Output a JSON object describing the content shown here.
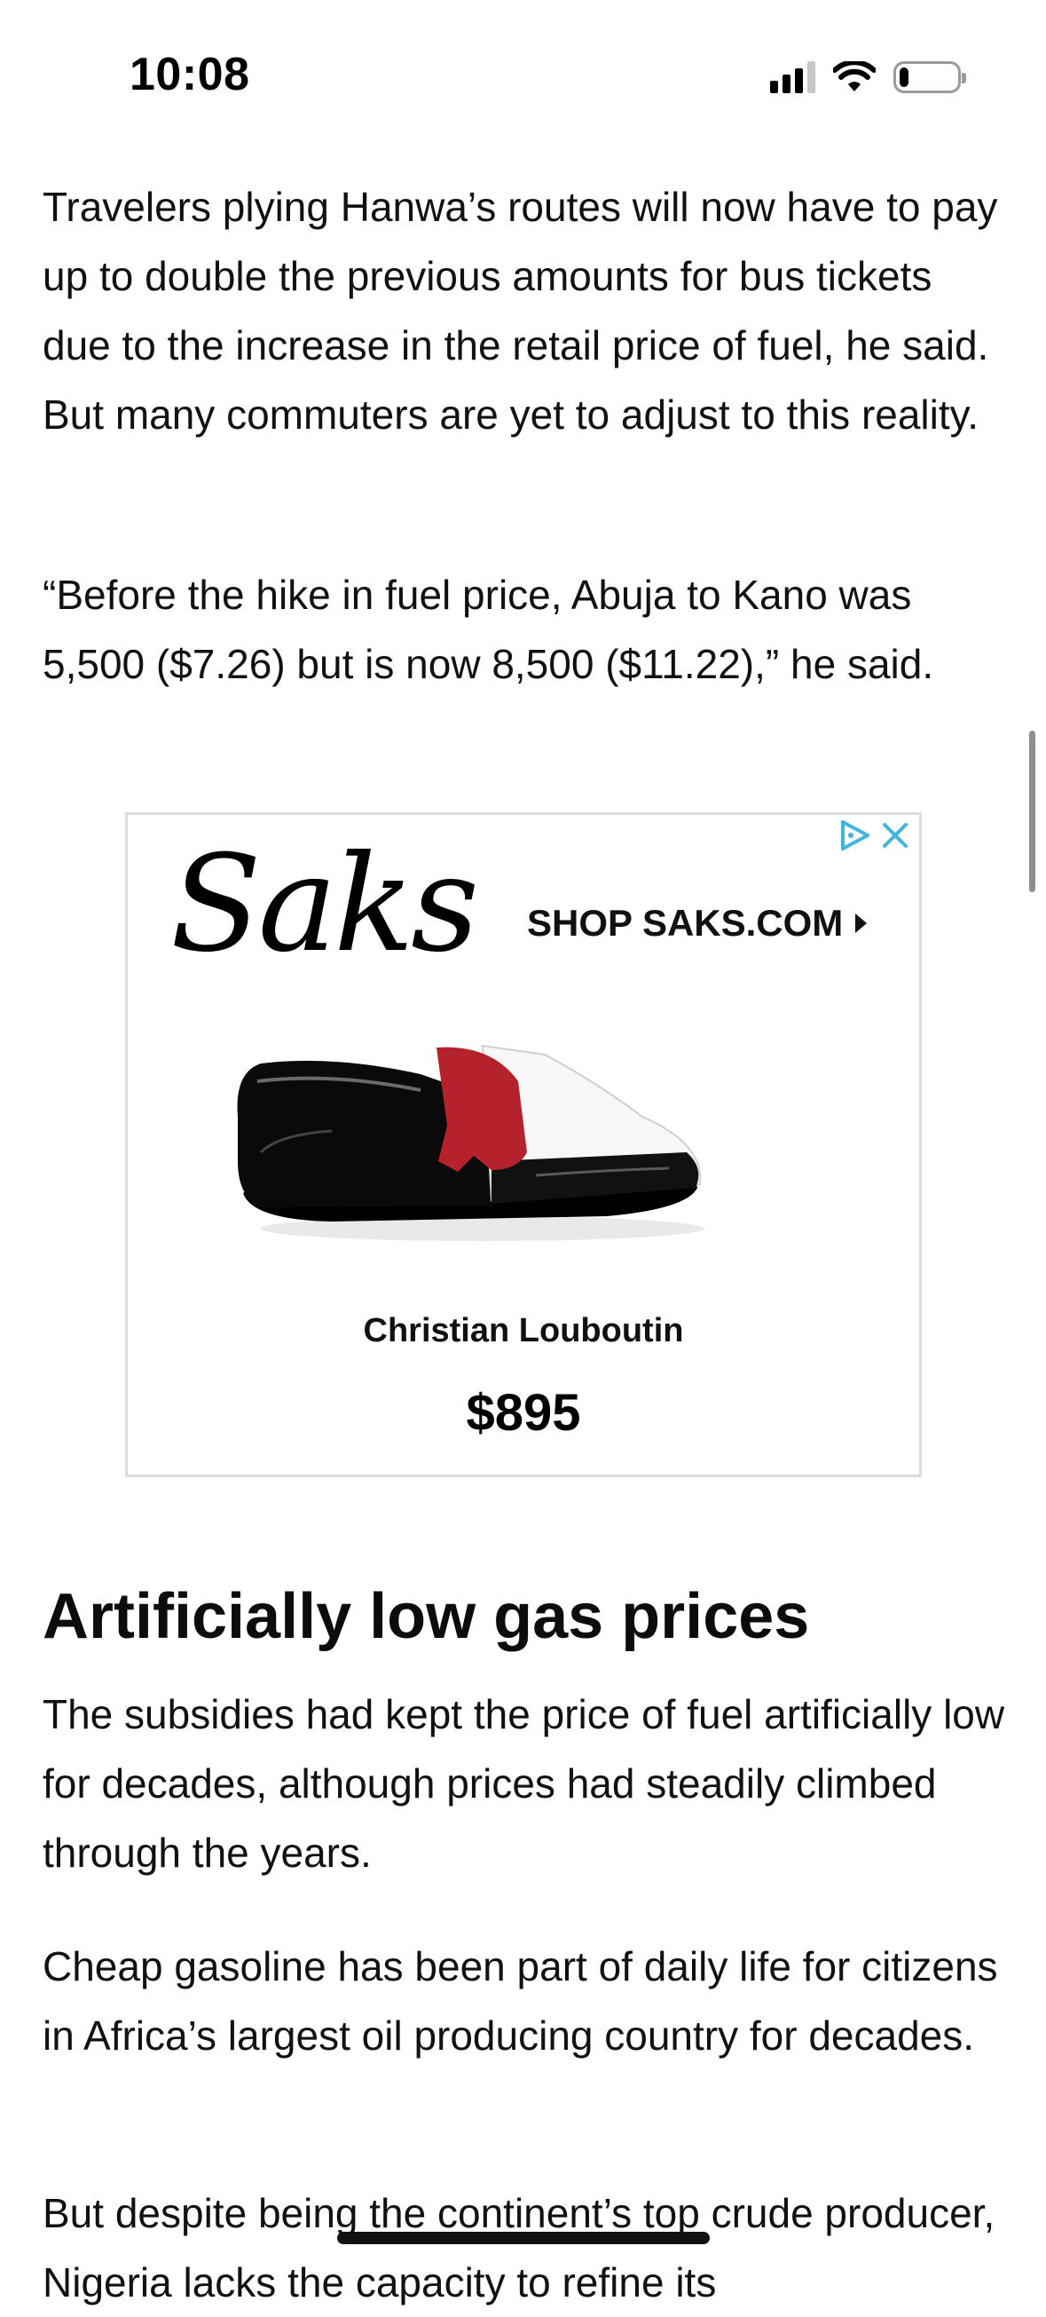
{
  "status_bar": {
    "time": "10:08",
    "signal_icon": "cellular-signal-icon",
    "wifi_icon": "wifi-icon",
    "battery_icon": "battery-icon",
    "battery_level": 0.15
  },
  "article": {
    "paragraphs_top": [
      "Travelers plying Hanwa’s routes will now have to pay up to double the previous amounts for bus tickets due to the increase in the retail price of fuel, he said. But many commuters are yet to adjust to this reality.",
      "“Before the hike in fuel price, Abuja to Kano was 5,500 ($7.26) but is now 8,500 ($11.22),” he said."
    ],
    "heading": "Artificially low gas prices",
    "paragraphs_bottom": [
      "The subsidies had kept the price of fuel artificially low for decades, although prices had steadily climbed through the years.",
      "Cheap gasoline has been part of daily life for citizens in Africa’s largest oil producing country for decades.",
      "But despite being the continent’s top crude producer, Nigeria lacks the capacity to refine its"
    ]
  },
  "ad": {
    "logo": "Saks",
    "cta": "SHOP SAKS.COM",
    "brand": "Christian Louboutin",
    "price": "$895",
    "adchoices_icon": "adchoices-icon",
    "close_icon": "close-icon",
    "product_icon": "loafer-shoe-image",
    "colors": {
      "adchoices": "#3fb6d8",
      "shoe_red": "#b5222b",
      "shoe_black": "#0a0a0a"
    }
  }
}
